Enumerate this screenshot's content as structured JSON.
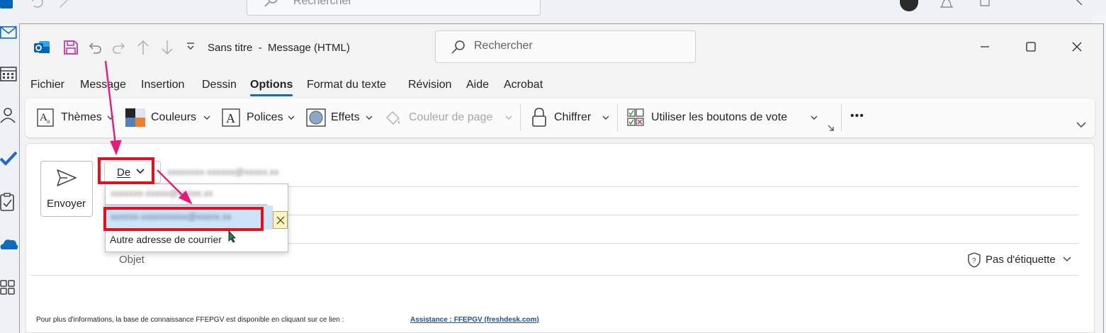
{
  "background_window": {
    "search_placeholder": "Rechercher"
  },
  "compose": {
    "title": "Sans titre  -  Message (HTML)",
    "search_placeholder": "Rechercher",
    "tabs": [
      "Fichier",
      "Message",
      "Insertion",
      "Dessin",
      "Options",
      "Format du texte",
      "Révision",
      "Aide",
      "Acrobat"
    ],
    "active_tab": "Options",
    "ribbon": {
      "themes": "Thèmes",
      "colors": "Couleurs",
      "fonts": "Polices",
      "effects": "Effets",
      "page_color": "Couleur de page",
      "encrypt": "Chiffrer",
      "voting": "Utiliser les boutons de vote",
      "more": "•••"
    },
    "send_label": "Envoyer",
    "from_label": "De",
    "from_dropdown": {
      "other_address": "Autre adresse de courrier"
    },
    "subject_label": "Objet",
    "sensitivity_label": "Pas d'étiquette",
    "footer_text": "Pour plus d'informations, la base de connaissance FFEPGV est disponible en cliquant sur ce lien :",
    "footer_link": "Assistance : FFEPGV (freshdesk.com)"
  },
  "colors": {
    "accent": "#0f6cbd",
    "annotation_red": "#e3101e",
    "annotation_arrow": "#e8187c",
    "selection": "#cde4f7",
    "outlook_blue": "#0364b8",
    "save_icon": "#c239b3"
  }
}
